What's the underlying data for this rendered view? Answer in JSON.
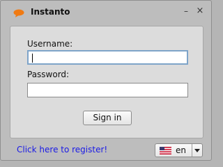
{
  "window": {
    "title": "Instanto",
    "minimize_label": "–",
    "close_label": "×"
  },
  "login": {
    "username_label": "Username:",
    "username_value": "",
    "password_label": "Password:",
    "password_value": "",
    "sign_in_label": "Sign in"
  },
  "footer": {
    "register_link": "Click here to register!",
    "language_value": "en"
  },
  "icons": {
    "app": "speech-bubble-icon",
    "flag": "us-flag-icon",
    "dropdown": "chevron-down-icon"
  },
  "colors": {
    "link": "#1a1ae6",
    "app_icon": "#f07a12",
    "focus_border": "#7ea4c9"
  }
}
